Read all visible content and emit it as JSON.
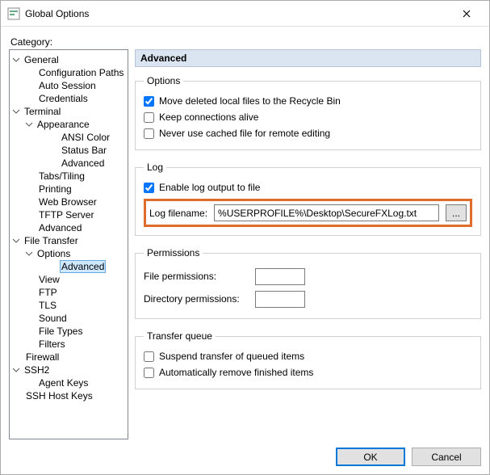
{
  "title": "Global Options",
  "category_label": "Category:",
  "tree": {
    "general": {
      "label": "General",
      "children": [
        "Configuration Paths",
        "Auto Session",
        "Credentials"
      ]
    },
    "terminal": {
      "label": "Terminal",
      "appearance": {
        "label": "Appearance",
        "children": [
          "ANSI Color",
          "Status Bar",
          "Advanced"
        ]
      },
      "children": [
        "Tabs/Tiling",
        "Printing",
        "Web Browser",
        "TFTP Server",
        "Advanced"
      ]
    },
    "file_transfer": {
      "label": "File Transfer",
      "options": {
        "label": "Options",
        "children": [
          "Advanced"
        ]
      },
      "children": [
        "View",
        "FTP",
        "TLS",
        "Sound",
        "File Types",
        "Filters"
      ]
    },
    "firewall": "Firewall",
    "ssh2": {
      "label": "SSH2",
      "children": [
        "Agent Keys"
      ]
    },
    "ssh_host_keys": "SSH Host Keys"
  },
  "panel": {
    "title": "Advanced",
    "options": {
      "legend": "Options",
      "recycle": "Move deleted local files to the Recycle Bin",
      "keep_alive": "Keep connections alive",
      "no_cache": "Never use cached file for remote editing"
    },
    "log": {
      "legend": "Log",
      "enable": "Enable log output to file",
      "filename_label": "Log filename:",
      "filename_value": "%USERPROFILE%\\Desktop\\SecureFXLog.txt",
      "browse": "..."
    },
    "permissions": {
      "legend": "Permissions",
      "file_label": "File permissions:",
      "file_value": "",
      "dir_label": "Directory permissions:",
      "dir_value": ""
    },
    "queue": {
      "legend": "Transfer queue",
      "suspend": "Suspend transfer of queued items",
      "auto_remove": "Automatically remove finished items"
    }
  },
  "footer": {
    "ok": "OK",
    "cancel": "Cancel"
  }
}
